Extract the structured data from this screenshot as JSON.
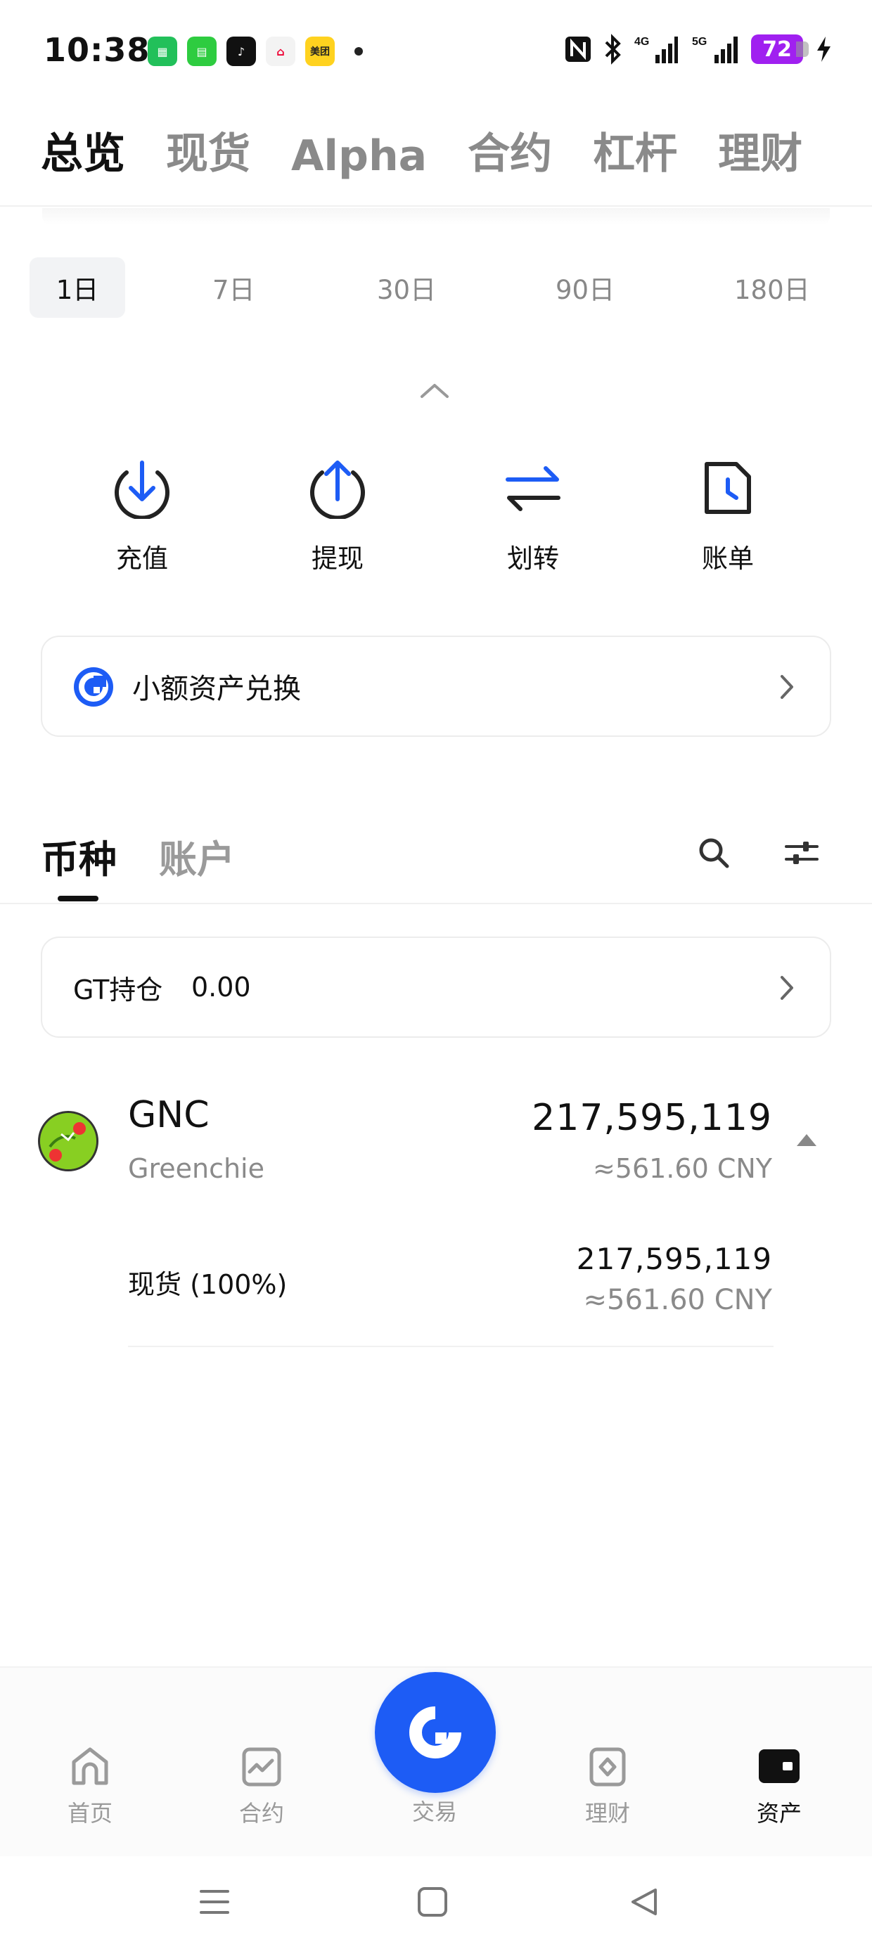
{
  "status_bar": {
    "time": "10:38",
    "battery": "72",
    "network_1": "4G",
    "network_2": "5G",
    "app_icons": [
      "green-app-icon",
      "messages-icon",
      "tiktok-icon",
      "home-app-icon",
      "meituan-icon"
    ],
    "meituan_label": "美团"
  },
  "top_tabs": [
    {
      "label": "总览",
      "active": true
    },
    {
      "label": "现货",
      "active": false
    },
    {
      "label": "Alpha",
      "active": false
    },
    {
      "label": "合约",
      "active": false
    },
    {
      "label": "杠杆",
      "active": false
    },
    {
      "label": "理财",
      "active": false
    }
  ],
  "periods": [
    {
      "label": "1日",
      "active": true
    },
    {
      "label": "7日",
      "active": false
    },
    {
      "label": "30日",
      "active": false
    },
    {
      "label": "90日",
      "active": false
    },
    {
      "label": "180日",
      "active": false
    }
  ],
  "actions": [
    {
      "label": "充值",
      "icon": "deposit-icon"
    },
    {
      "label": "提现",
      "icon": "withdraw-icon"
    },
    {
      "label": "划转",
      "icon": "transfer-icon"
    },
    {
      "label": "账单",
      "icon": "bill-icon"
    }
  ],
  "dust_convert": {
    "label": "小额资产兑换"
  },
  "asset_tabs": [
    {
      "label": "币种",
      "active": true
    },
    {
      "label": "账户",
      "active": false
    }
  ],
  "gt_holding": {
    "label": "GT持仓",
    "value": "0.00"
  },
  "coin": {
    "symbol": "GNC",
    "name": "Greenchie",
    "amount": "217,595,119",
    "cny": "≈561.60 CNY",
    "breakdown": {
      "label": "现货 (100%)",
      "amount": "217,595,119",
      "cny": "≈561.60 CNY"
    }
  },
  "bottom_nav": [
    {
      "label": "首页",
      "active": false
    },
    {
      "label": "合约",
      "active": false
    },
    {
      "label": "交易",
      "active": false
    },
    {
      "label": "理财",
      "active": false
    },
    {
      "label": "资产",
      "active": true
    }
  ],
  "colors": {
    "accent": "#1d5cf5",
    "battery": "#a020f0",
    "text_primary": "#111111",
    "text_secondary": "#8a8a8a"
  }
}
